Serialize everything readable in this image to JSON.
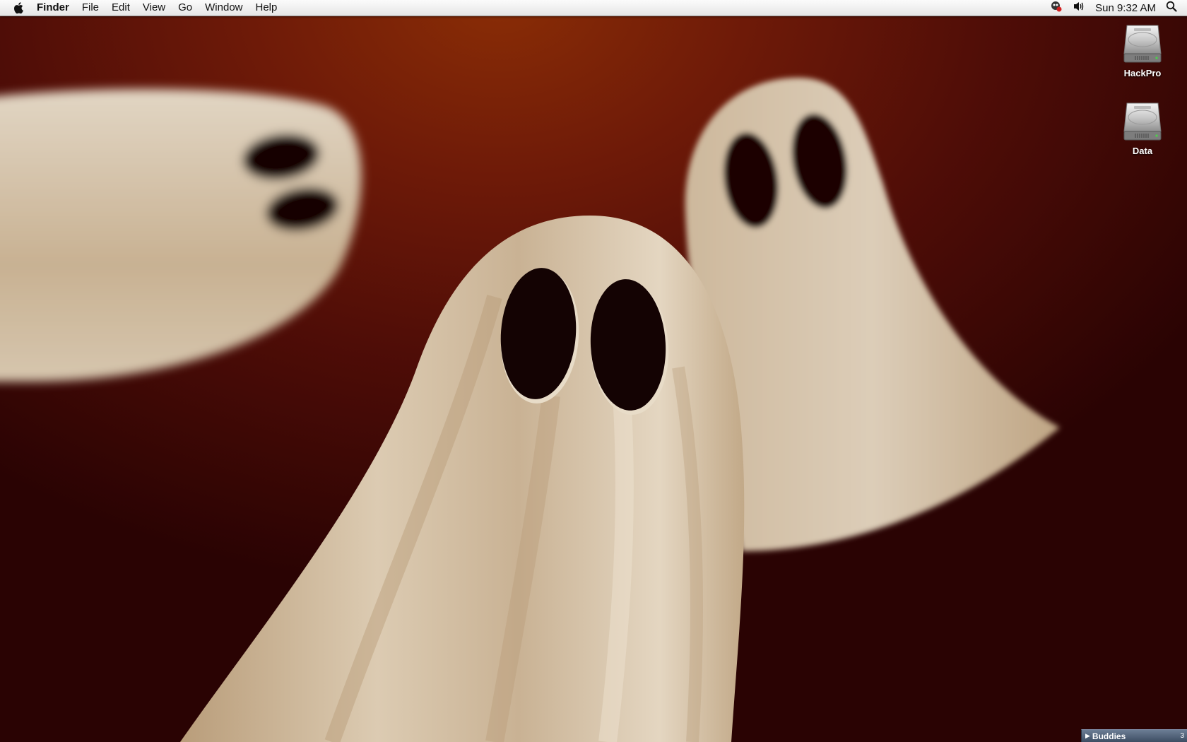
{
  "menubar": {
    "app_name": "Finder",
    "menus": [
      "File",
      "Edit",
      "View",
      "Go",
      "Window",
      "Help"
    ],
    "status_icons": [
      "chat-status-icon",
      "volume-icon"
    ],
    "clock": "Sun 9:32 AM",
    "spotlight_icon": "search-icon"
  },
  "desktop_icons": [
    {
      "label": "HackPro",
      "icon": "hard-drive-icon"
    },
    {
      "label": "Data",
      "icon": "hard-drive-icon"
    }
  ],
  "buddies_bar": {
    "label": "Buddies",
    "count": "3"
  },
  "colors": {
    "wallpaper_center": "#8a2d06",
    "wallpaper_edge": "#2a0303",
    "ghost_body": "#d9cbb6",
    "ghost_eyes": "#140303"
  }
}
